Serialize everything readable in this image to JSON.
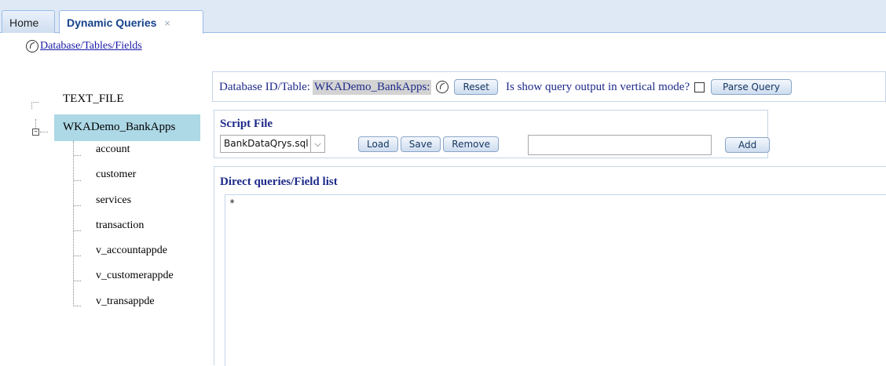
{
  "tabs": {
    "home": "Home",
    "active": "Dynamic Queries",
    "close_glyph": "×"
  },
  "tree": {
    "root_label": "Database/Tables/Fields",
    "nodes": [
      {
        "label": "TEXT_FILE"
      },
      {
        "label": "WKADemo_BankApps",
        "selected": true,
        "children": [
          "account",
          "customer",
          "services",
          "transaction",
          "v_accountappde",
          "v_customerappde",
          "v_transappde"
        ]
      }
    ]
  },
  "db_row": {
    "label": "Database ID/Table:",
    "db_value": "WKADemo_BankApps:",
    "reset_label": "Reset",
    "vertical_label": "Is show query output in vertical mode?",
    "vertical_checked": false,
    "parse_label": "Parse Query"
  },
  "script_file": {
    "title": "Script File",
    "selected": "BankDataQrys.sql",
    "load_label": "Load",
    "save_label": "Save",
    "remove_label": "Remove",
    "new_name_value": "",
    "add_label": "Add"
  },
  "direct_queries": {
    "title": "Direct queries/Field list",
    "value": "*"
  },
  "colors": {
    "tab_bar": "#dfe9f5",
    "selected_node": "#add8e6",
    "label_blue": "#1e2a8a"
  }
}
